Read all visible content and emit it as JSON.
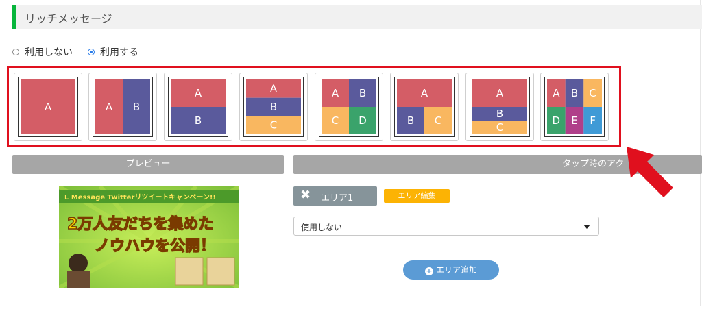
{
  "header": {
    "title": "リッチメッセージ"
  },
  "usage": {
    "options": [
      {
        "label": "利用しない",
        "selected": false
      },
      {
        "label": "利用する",
        "selected": true
      }
    ]
  },
  "templates": [
    {
      "labels": [
        "A"
      ]
    },
    {
      "labels": [
        "A",
        "B"
      ]
    },
    {
      "labels": [
        "A",
        "B"
      ]
    },
    {
      "labels": [
        "A",
        "B",
        "C"
      ]
    },
    {
      "labels": [
        "A",
        "B",
        "C",
        "D"
      ]
    },
    {
      "labels": [
        "A",
        "B",
        "C"
      ]
    },
    {
      "labels": [
        "A",
        "B",
        "C"
      ]
    },
    {
      "labels": [
        "A",
        "B",
        "C",
        "D",
        "E",
        "F"
      ]
    }
  ],
  "colors": {
    "red": "#d45d66",
    "purple": "#5a5a9c",
    "orange": "#f9b760",
    "green": "#3aa36b",
    "magenta": "#b03f8a",
    "blue": "#3f9ad6",
    "accent_green": "#07b53b",
    "highlight": "#e0101e"
  },
  "preview_panel": {
    "header": "プレビュー"
  },
  "tap_panel": {
    "header": "タップ時のアク"
  },
  "banner": {
    "top_line": "L Message  Twitterリツイートキャンペーン!!",
    "headline_1": "2万人友だちを集めた",
    "headline_2": "ノウハウを公開！"
  },
  "area": {
    "name": "エリア1",
    "edit_label": "エリア編集",
    "action_select": "使用しない",
    "add_label": "エリア追加"
  }
}
